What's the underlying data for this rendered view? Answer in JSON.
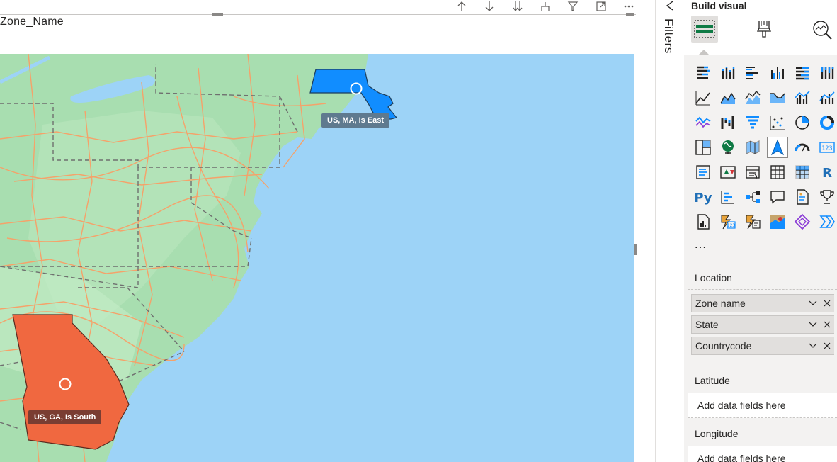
{
  "canvas": {
    "visual_title": "Zone_Name",
    "toolbar_icons": [
      "arrow-up-icon",
      "arrow-down-icon",
      "double-arrow-down-icon",
      "expand-hierarchy-icon",
      "filter-icon",
      "focus-mode-icon",
      "more-options-icon"
    ],
    "map": {
      "labels": {
        "east": "US, MA, Is East",
        "south": "US, GA, Is South"
      },
      "colors": {
        "ocean": "#9dd3f7",
        "land": "#a8deb0",
        "roads": "#f5a26a",
        "borders": "#6f6f6f",
        "east_region": "#118dff",
        "south_region": "#f06840"
      }
    }
  },
  "filters": {
    "label": "Filters"
  },
  "build_visual": {
    "title": "Build visual",
    "tabs": [
      "build-visual-tab",
      "format-visual-tab",
      "analytics-tab"
    ],
    "visual_types": [
      "stacked-bar",
      "stacked-column",
      "clustered-bar",
      "clustered-column",
      "100-stacked-bar",
      "100-stacked-column",
      "line",
      "area",
      "stacked-area",
      "ribbon",
      "line-clustered-column",
      "line-stacked-column",
      "waterfall",
      "funnel",
      "scatter",
      "pie",
      "donut",
      "treemap",
      "map",
      "filled-map",
      "shape-map",
      "azure-map",
      "gauge",
      "card",
      "multi-row-card",
      "kpi",
      "slicer",
      "table",
      "matrix",
      "r-script",
      "python",
      "key-influencers",
      "decomposition-tree",
      "qa",
      "smart-narrative",
      "goals",
      "paginated-report",
      "power-automate",
      "text-slicer",
      "arcgis",
      "power-apps",
      "selection-tool"
    ],
    "selected_visual": "azure-map",
    "more_label": "…",
    "location": {
      "label": "Location",
      "fields": [
        "Zone name",
        "State",
        "Countrycode"
      ]
    },
    "latitude": {
      "label": "Latitude",
      "placeholder": "Add data fields here"
    },
    "longitude": {
      "label": "Longitude",
      "placeholder": "Add data fields here"
    }
  }
}
